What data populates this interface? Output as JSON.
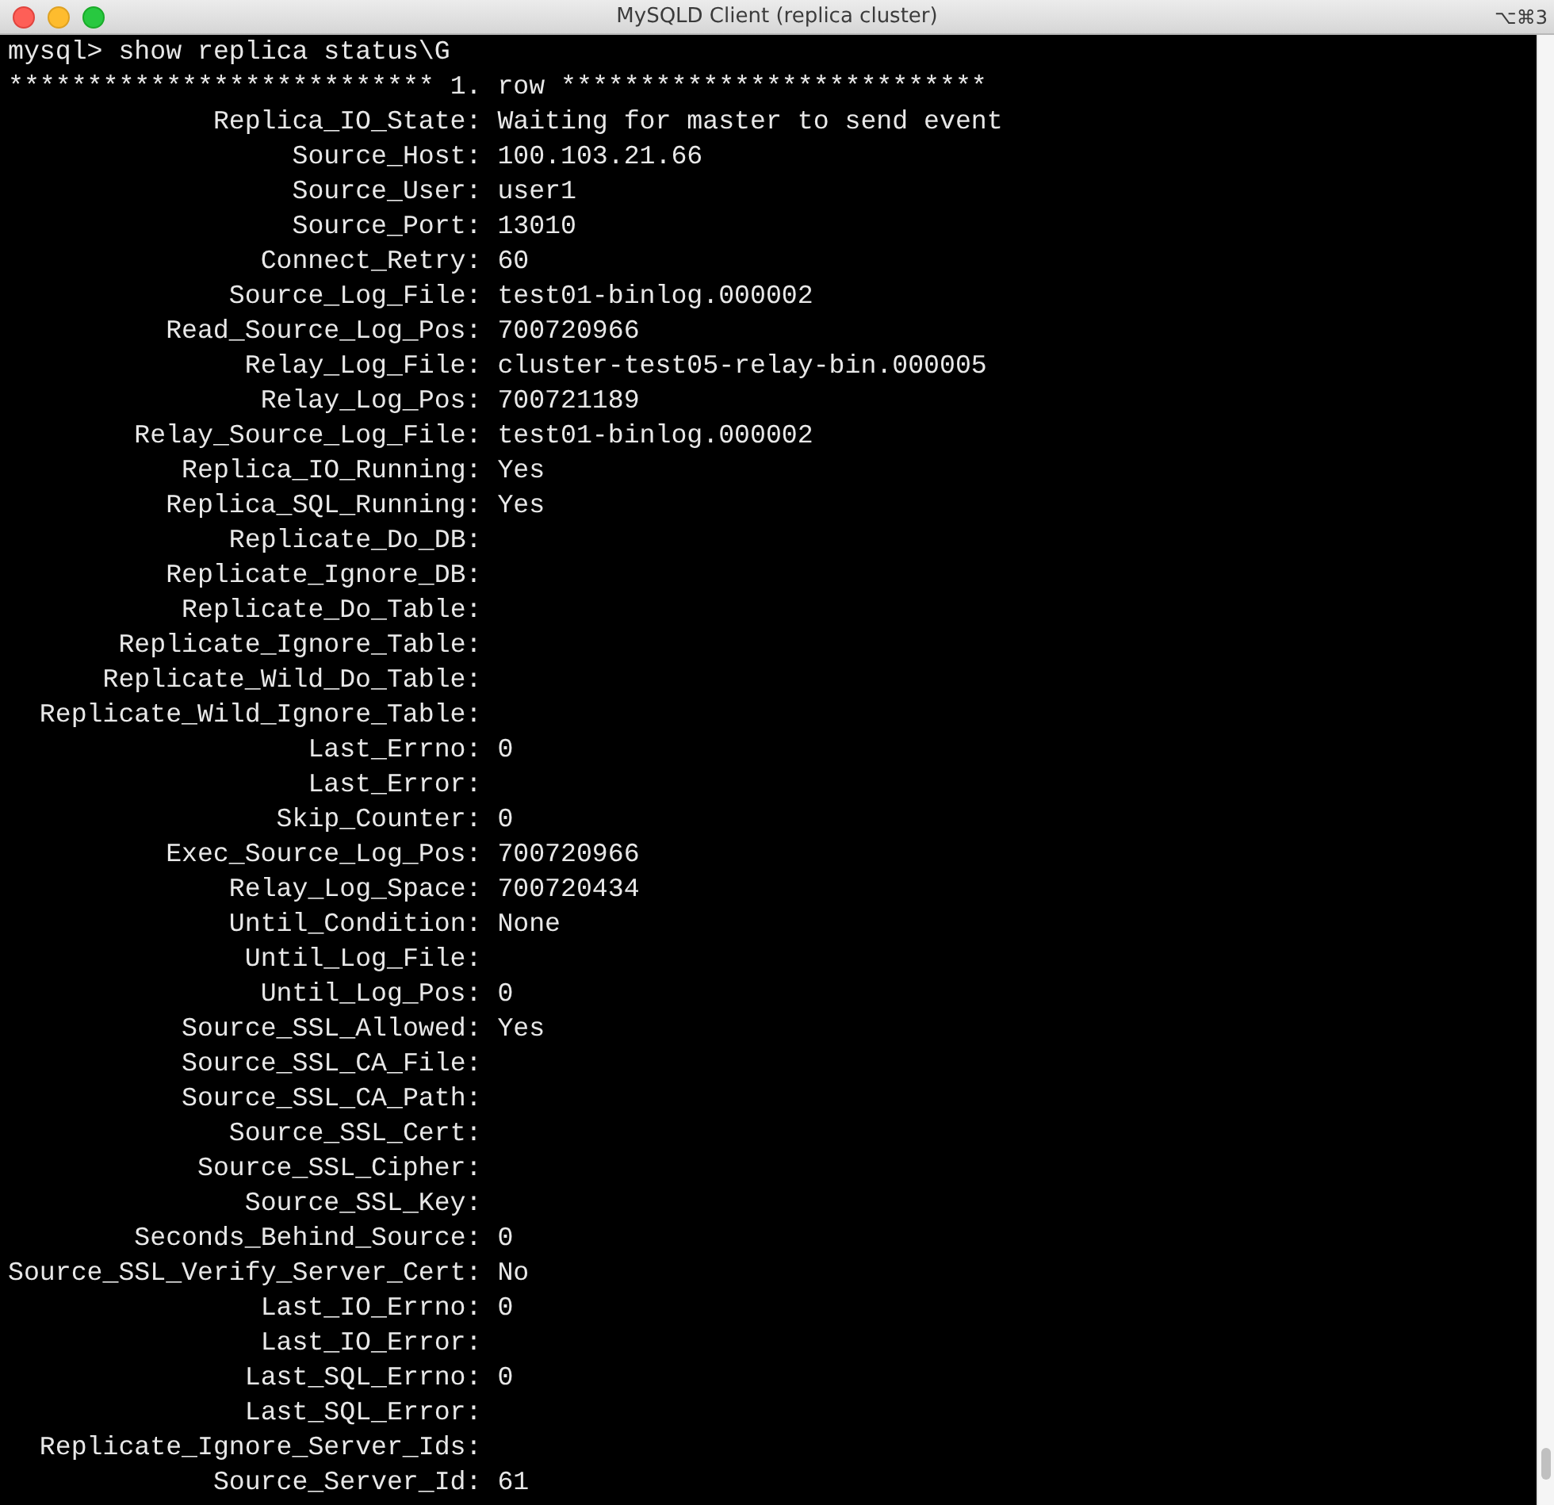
{
  "window": {
    "title": "MySQLD Client (replica cluster)",
    "shortcut": "⌥⌘3"
  },
  "terminal": {
    "command_line": "mysql> show replica status\\G",
    "row_header": "*************************** 1. row ***************************",
    "fields": [
      {
        "label": "Replica_IO_State:",
        "value": "Waiting for master to send event"
      },
      {
        "label": "Source_Host:",
        "value": "100.103.21.66"
      },
      {
        "label": "Source_User:",
        "value": "user1"
      },
      {
        "label": "Source_Port:",
        "value": "13010"
      },
      {
        "label": "Connect_Retry:",
        "value": "60"
      },
      {
        "label": "Source_Log_File:",
        "value": "test01-binlog.000002"
      },
      {
        "label": "Read_Source_Log_Pos:",
        "value": "700720966"
      },
      {
        "label": "Relay_Log_File:",
        "value": "cluster-test05-relay-bin.000005"
      },
      {
        "label": "Relay_Log_Pos:",
        "value": "700721189"
      },
      {
        "label": "Relay_Source_Log_File:",
        "value": "test01-binlog.000002"
      },
      {
        "label": "Replica_IO_Running:",
        "value": "Yes"
      },
      {
        "label": "Replica_SQL_Running:",
        "value": "Yes"
      },
      {
        "label": "Replicate_Do_DB:"
      },
      {
        "label": "Replicate_Ignore_DB:"
      },
      {
        "label": "Replicate_Do_Table:"
      },
      {
        "label": "Replicate_Ignore_Table:"
      },
      {
        "label": "Replicate_Wild_Do_Table:"
      },
      {
        "label": "Replicate_Wild_Ignore_Table:"
      },
      {
        "label": "Last_Errno:",
        "value": "0"
      },
      {
        "label": "Last_Error:"
      },
      {
        "label": "Skip_Counter:",
        "value": "0"
      },
      {
        "label": "Exec_Source_Log_Pos:",
        "value": "700720966"
      },
      {
        "label": "Relay_Log_Space:",
        "value": "700720434"
      },
      {
        "label": "Until_Condition:",
        "value": "None"
      },
      {
        "label": "Until_Log_File:"
      },
      {
        "label": "Until_Log_Pos:",
        "value": "0"
      },
      {
        "label": "Source_SSL_Allowed:",
        "value": "Yes"
      },
      {
        "label": "Source_SSL_CA_File:"
      },
      {
        "label": "Source_SSL_CA_Path:"
      },
      {
        "label": "Source_SSL_Cert:"
      },
      {
        "label": "Source_SSL_Cipher:"
      },
      {
        "label": "Source_SSL_Key:"
      },
      {
        "label": "Seconds_Behind_Source:",
        "value": "0"
      },
      {
        "label": "Source_SSL_Verify_Server_Cert:",
        "value": "No"
      },
      {
        "label": "Last_IO_Errno:",
        "value": "0"
      },
      {
        "label": "Last_IO_Error:"
      },
      {
        "label": "Last_SQL_Errno:",
        "value": "0"
      },
      {
        "label": "Last_SQL_Error:"
      },
      {
        "label": "Replicate_Ignore_Server_Ids:"
      },
      {
        "label": "Source_Server_Id:",
        "value": "61"
      }
    ]
  }
}
